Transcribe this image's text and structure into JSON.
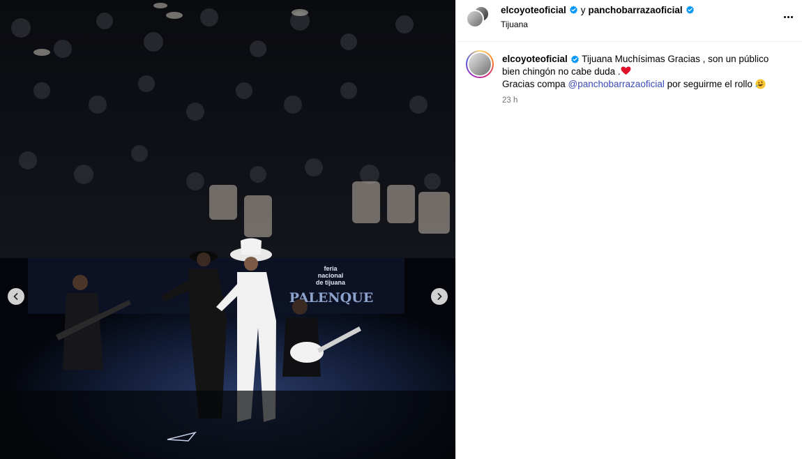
{
  "post": {
    "header": {
      "user1": "elcoyoteoficial",
      "connector": "y",
      "user2": "panchobarrazaoficial",
      "location": "Tijuana"
    },
    "caption": {
      "username": "elcoyoteoficial",
      "line1": "Tijuana Muchísimas Gracias , son un público",
      "line2": "bien chingón no cabe duda .",
      "line3_prefix": "Gracias compa ",
      "mention": "@panchobarrazaoficial",
      "line3_suffix": " por seguirme el rollo",
      "timestamp": "23 h"
    },
    "media": {
      "stage_sign_1": "feria",
      "stage_sign_2": "nacional",
      "stage_sign_3": "de tijuana",
      "stage_banner": "PALENQUE"
    }
  },
  "icons": {
    "verified": "verified-badge-icon",
    "more": "more-options-icon",
    "prev": "chevron-left-icon",
    "next": "chevron-right-icon",
    "heart": "red-heart-emoji",
    "laugh": "rofl-emoji"
  },
  "colors": {
    "verified_blue": "#0095f6",
    "mention_blue": "#3a4ab8",
    "muted_gray": "#737373"
  }
}
